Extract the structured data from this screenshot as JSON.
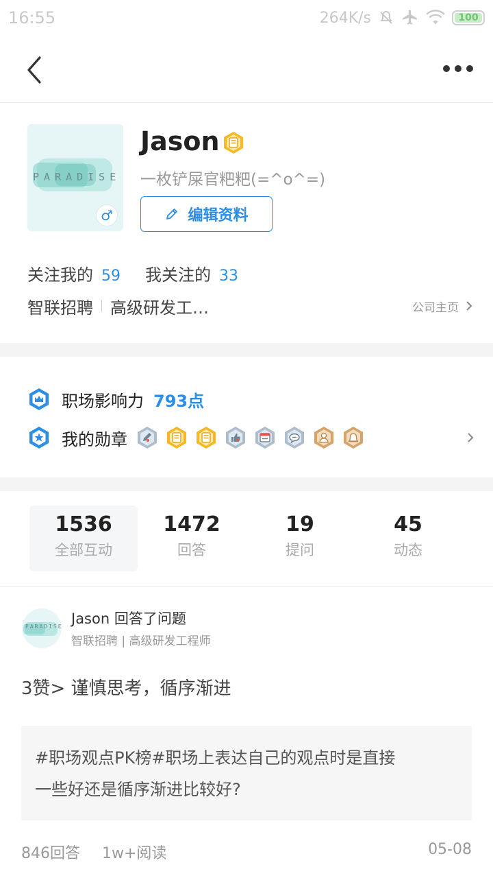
{
  "status_bar": {
    "time": "16:55",
    "net_speed": "264K/s",
    "battery": "100"
  },
  "nav": {
    "back_icon": "back-arrow-icon",
    "more_icon": "more-dots-icon"
  },
  "profile": {
    "avatar_text": "PARADISE",
    "name": "Jason",
    "signature": "一枚铲屎官粑粑(=^o^=)",
    "edit_label": "编辑资料",
    "followers_label": "关注我的",
    "followers_count": "59",
    "following_label": "我关注的",
    "following_count": "33",
    "company": "智联招聘",
    "position": "高级研发工…",
    "company_home_label": "公司主页"
  },
  "achievements": {
    "influence_label": "职场影响力",
    "influence_value": "793点",
    "medals_label": "我的勋章",
    "medal_icons": [
      "pen-medal-icon",
      "document-medal-icon",
      "document-medal-icon",
      "thumbs-up-medal-icon",
      "calendar-medal-icon",
      "chat-medal-icon",
      "user-medal-icon",
      "bell-medal-icon"
    ]
  },
  "stats": [
    {
      "num": "1536",
      "label": "全部互动"
    },
    {
      "num": "1472",
      "label": "回答"
    },
    {
      "num": "19",
      "label": "提问"
    },
    {
      "num": "45",
      "label": "动态"
    }
  ],
  "feed": {
    "avatar_text": "PARADISE",
    "author": "Jason 回答了问题",
    "sub": "智联招聘 | 高级研发工程师",
    "title": "3赞> 谨慎思考，循序渐进",
    "question_line1": "#职场观点PK榜#职场上表达自己的观点时是直接",
    "question_line2": "一些好还是循序渐进比较好?",
    "answers": "846回答",
    "reads": "1w+阅读",
    "date": "05-08"
  },
  "colors": {
    "accent": "#2c8ee6",
    "badge_gold": "#f5b827",
    "badge_gray": "#aebdcc",
    "badge_bronze": "#d4a46a"
  }
}
